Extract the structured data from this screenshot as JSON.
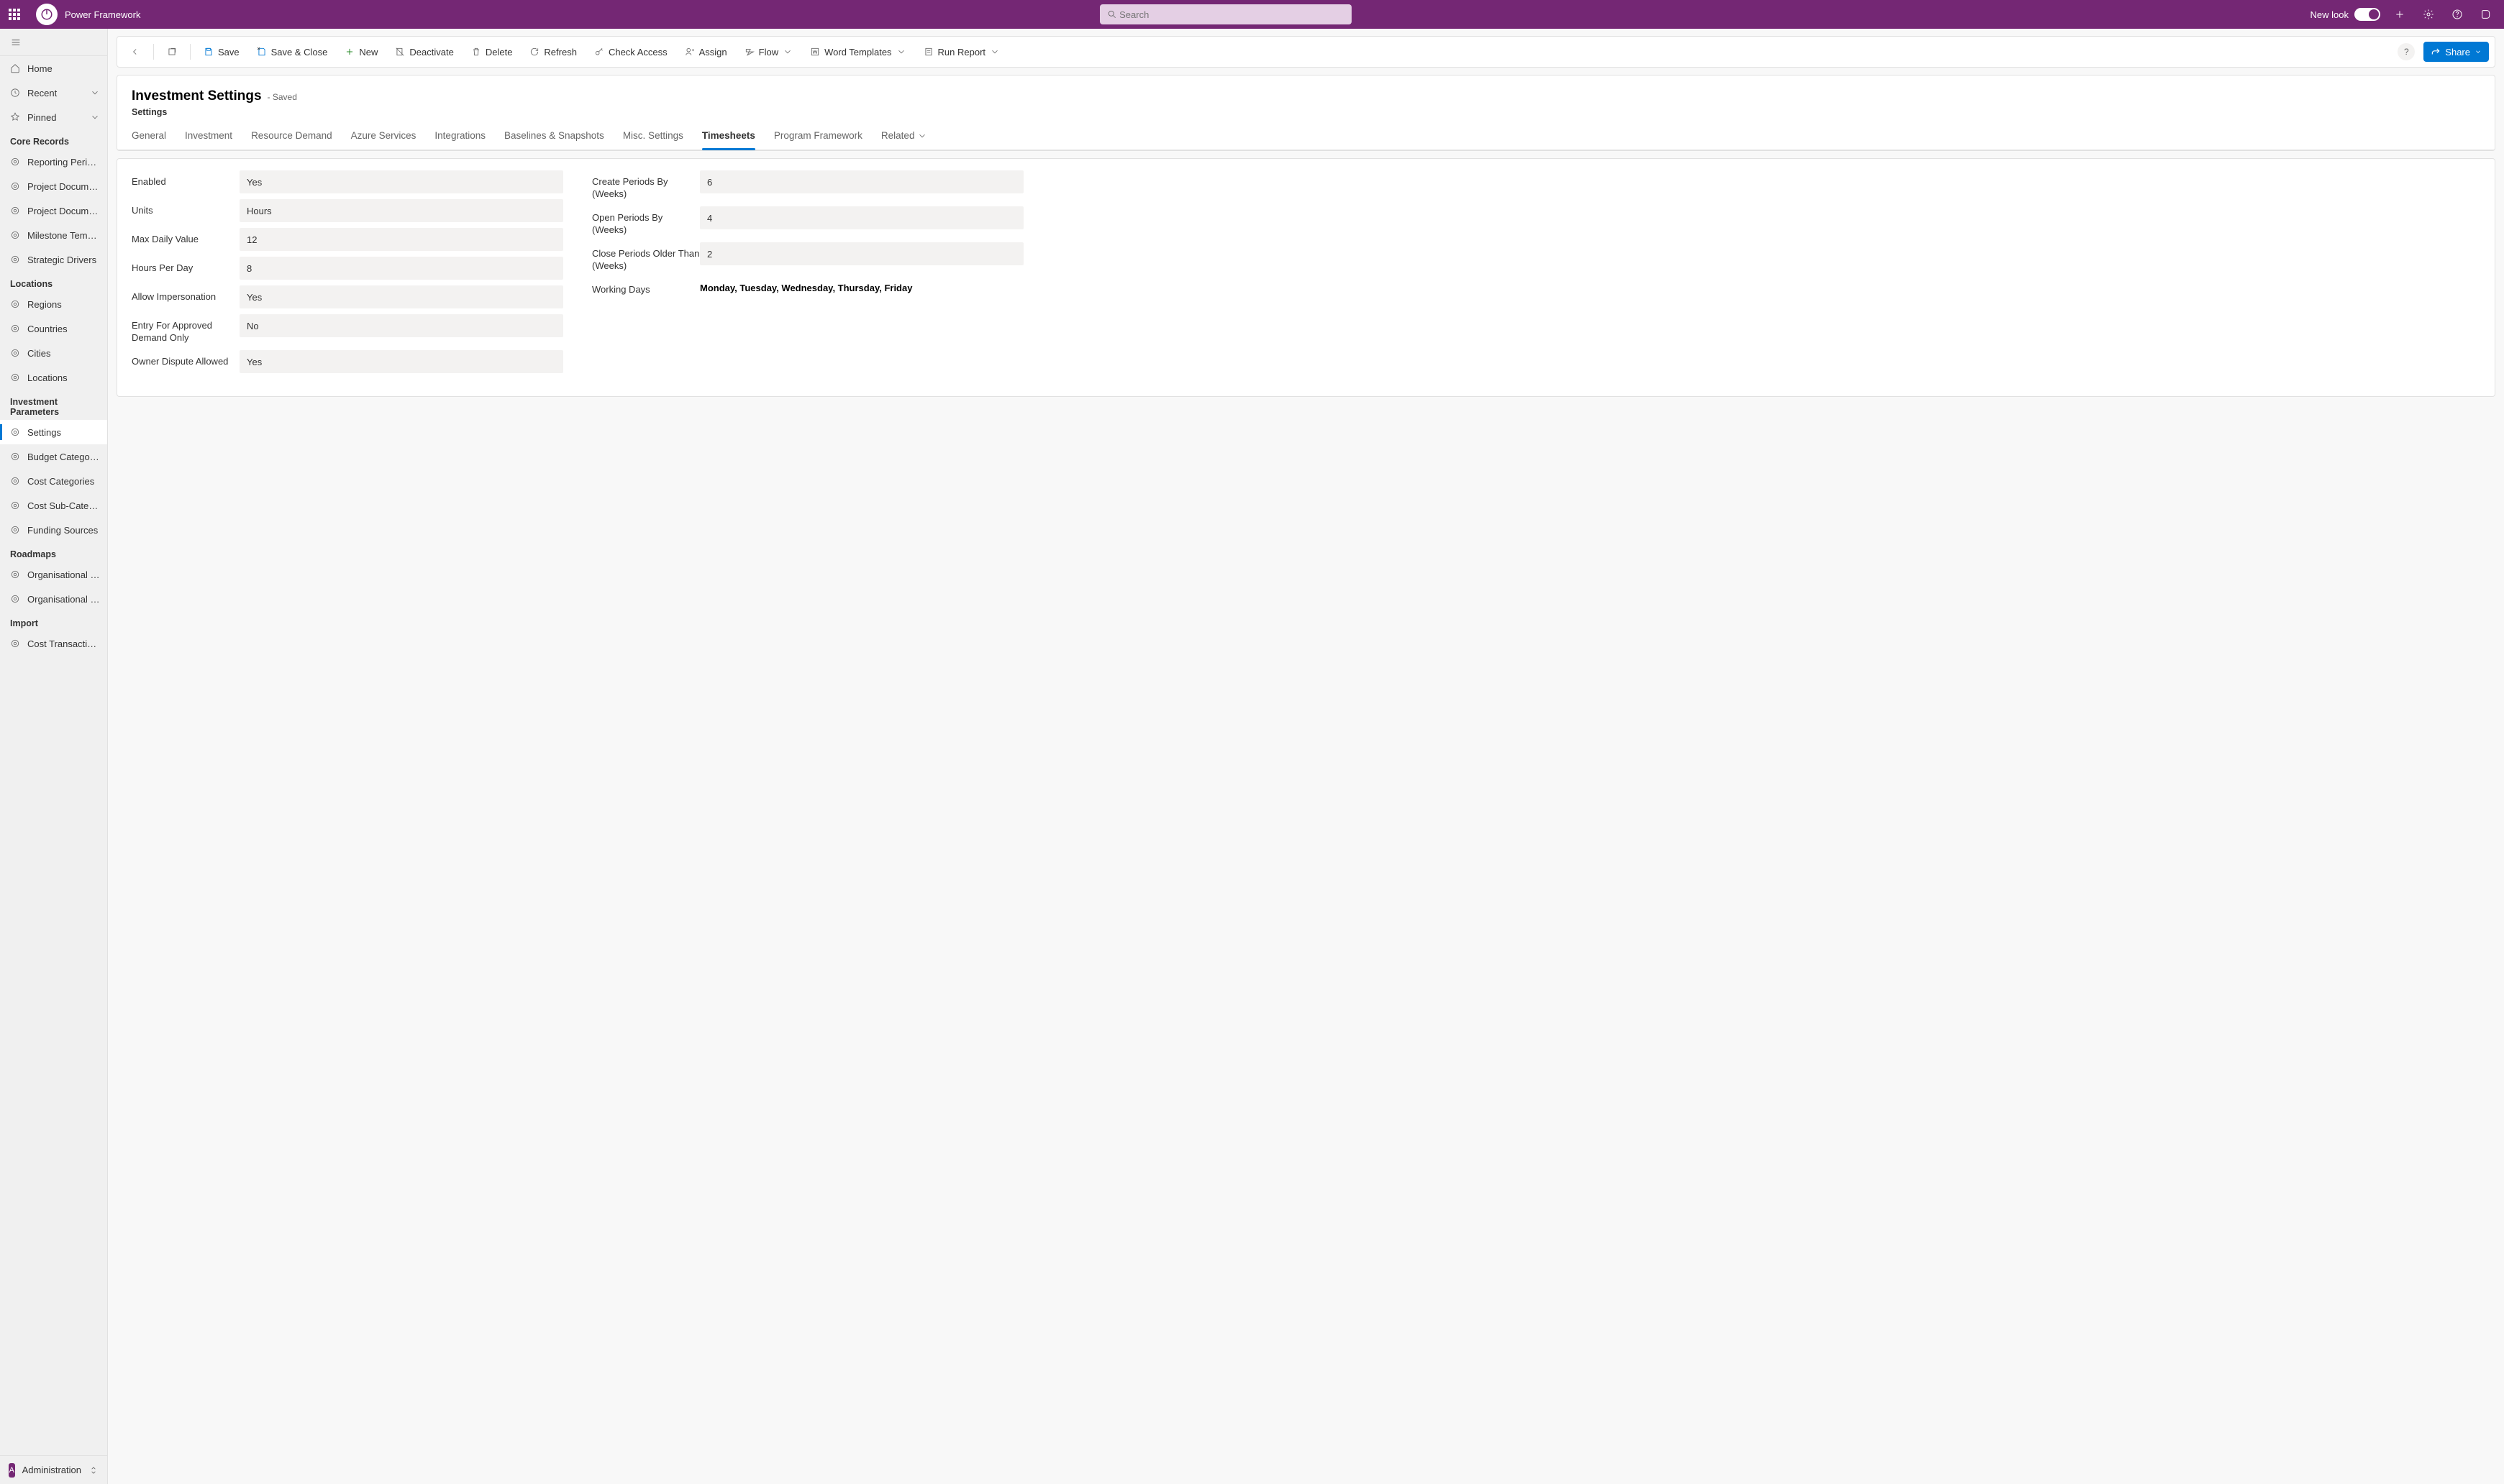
{
  "brand": "Power Framework",
  "search": {
    "placeholder": "Search"
  },
  "topbar": {
    "newlook": "New look"
  },
  "sidebar": {
    "home": "Home",
    "recent": "Recent",
    "pinned": "Pinned",
    "groups": {
      "core": "Core Records",
      "locations": "Locations",
      "invparams": "Investment Parameters",
      "roadmaps": "Roadmaps",
      "import": "Import"
    },
    "items": {
      "reporting_periods": "Reporting Periods",
      "project_doc1": "Project Document...",
      "project_doc2": "Project Document...",
      "milestone": "Milestone Templa...",
      "strategic": "Strategic Drivers",
      "regions": "Regions",
      "countries": "Countries",
      "cities": "Cities",
      "locations": "Locations",
      "settings": "Settings",
      "budget_cat": "Budget Categories",
      "cost_cat": "Cost Categories",
      "cost_sub": "Cost Sub-Categor...",
      "funding": "Funding Sources",
      "org1": "Organisational Ev...",
      "org2": "Organisational Ev...",
      "cost_trans": "Cost Transactions"
    },
    "area": {
      "badge": "A",
      "label": "Administration"
    }
  },
  "cmdbar": {
    "save": "Save",
    "save_close": "Save & Close",
    "new": "New",
    "deactivate": "Deactivate",
    "delete": "Delete",
    "refresh": "Refresh",
    "check_access": "Check Access",
    "assign": "Assign",
    "flow": "Flow",
    "word_templates": "Word Templates",
    "run_report": "Run Report",
    "share": "Share"
  },
  "form": {
    "title": "Investment Settings",
    "saved": "- Saved",
    "subtitle": "Settings",
    "tabs": {
      "general": "General",
      "investment": "Investment",
      "resource_demand": "Resource Demand",
      "azure": "Azure Services",
      "integrations": "Integrations",
      "baselines": "Baselines & Snapshots",
      "misc": "Misc. Settings",
      "timesheets": "Timesheets",
      "program": "Program Framework",
      "related": "Related"
    },
    "left": {
      "enabled": {
        "label": "Enabled",
        "value": "Yes"
      },
      "units": {
        "label": "Units",
        "value": "Hours"
      },
      "max_daily": {
        "label": "Max Daily Value",
        "value": "12"
      },
      "hours_per_day": {
        "label": "Hours Per Day",
        "value": "8"
      },
      "impersonation": {
        "label": "Allow Impersonation",
        "value": "Yes"
      },
      "approved_only": {
        "label": "Entry For Approved Demand Only",
        "value": "No"
      },
      "dispute": {
        "label": "Owner Dispute Allowed",
        "value": "Yes"
      }
    },
    "right": {
      "create_periods": {
        "label": "Create Periods By (Weeks)",
        "value": "6"
      },
      "open_periods": {
        "label": "Open Periods By (Weeks)",
        "value": "4"
      },
      "close_periods": {
        "label": "Close Periods Older Than (Weeks)",
        "value": "2"
      },
      "working_days": {
        "label": "Working Days",
        "value": "Monday, Tuesday, Wednesday, Thursday, Friday"
      }
    }
  }
}
